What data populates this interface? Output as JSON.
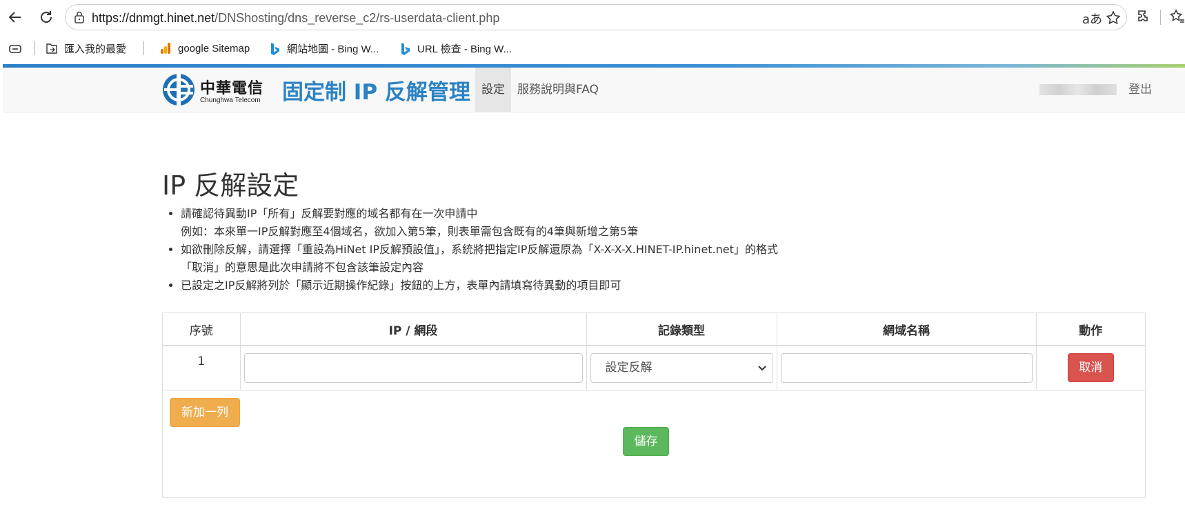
{
  "browser": {
    "url_host": "https://dnmgt.hinet.net",
    "url_path": "/DNShosting/dns_reverse_c2/rs-userdata-client.php",
    "bookmarks": [
      {
        "label": "匯入我的最愛"
      },
      {
        "label": "google Sitemap"
      },
      {
        "label": "網站地圖 - Bing W..."
      },
      {
        "label": "URL 檢查 - Bing W..."
      }
    ]
  },
  "header": {
    "logo_cn": "中華電信",
    "logo_en": "Chunghwa Telecom",
    "brand": "固定制 IP 反解管理",
    "nav": [
      {
        "label": "設定",
        "active": true
      },
      {
        "label": "服務說明與FAQ",
        "active": false
      }
    ],
    "logout": "登出"
  },
  "main": {
    "title": "IP 反解設定",
    "notes": [
      {
        "line1": "請確認待異動IP「所有」反解要對應的域名都有在一次申請中",
        "line2": "例如：本來單一IP反解對應至4個域名，欲加入第5筆，則表單需包含既有的4筆與新增之第5筆"
      },
      {
        "line1": "如欲刪除反解，請選擇「重設為HiNet IP反解預設值」，系統將把指定IP反解還原為「X-X-X-X.HINET-IP.hinet.net」的格式",
        "line2": "「取消」的意思是此次申請將不包含該筆設定內容"
      },
      {
        "line1": "已設定之IP反解將列於「顯示近期操作紀錄」按鈕的上方，表單內請填寫待異動的項目即可"
      }
    ],
    "table": {
      "headers": [
        "序號",
        "IP / 網段",
        "記錄類型",
        "網域名稱",
        "動作"
      ],
      "rows": [
        {
          "index": "1",
          "ip_value": "",
          "record_type": "設定反解",
          "domain_value": "",
          "action": "取消"
        }
      ]
    },
    "add_row_label": "新加一列",
    "save_label": "儲存"
  },
  "colors": {
    "brand": "#2a82c4",
    "cancel": "#d9534f",
    "add": "#f0ad4e",
    "save": "#5cb85c"
  }
}
